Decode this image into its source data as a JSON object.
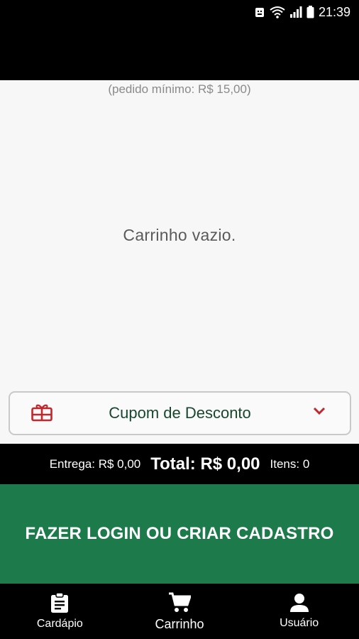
{
  "status_bar": {
    "time": "21:39",
    "icons": [
      "android-debug-icon",
      "wifi-icon",
      "signal-icon",
      "battery-icon"
    ]
  },
  "cart": {
    "min_order": "(pedido mínimo: R$ 15,00)",
    "empty_message": "Carrinho vazio."
  },
  "coupon": {
    "label": "Cupom de Desconto",
    "icon": "gift-card-icon",
    "chevron": "chevron-down-icon"
  },
  "totals": {
    "delivery": "Entrega: R$ 0,00",
    "total": "Total: R$ 0,00",
    "items": "Itens: 0"
  },
  "login_button": {
    "label": "FAZER LOGIN OU CRIAR CADASTRO"
  },
  "bottom_nav": {
    "items": [
      {
        "label": "Cardápio",
        "icon": "clipboard-icon"
      },
      {
        "label": "Carrinho",
        "icon": "cart-icon"
      },
      {
        "label": "Usuário",
        "icon": "user-icon"
      }
    ]
  },
  "colors": {
    "brand_green": "#1d7a4a",
    "coupon_red": "#c0282d",
    "coupon_text": "#17472c"
  }
}
